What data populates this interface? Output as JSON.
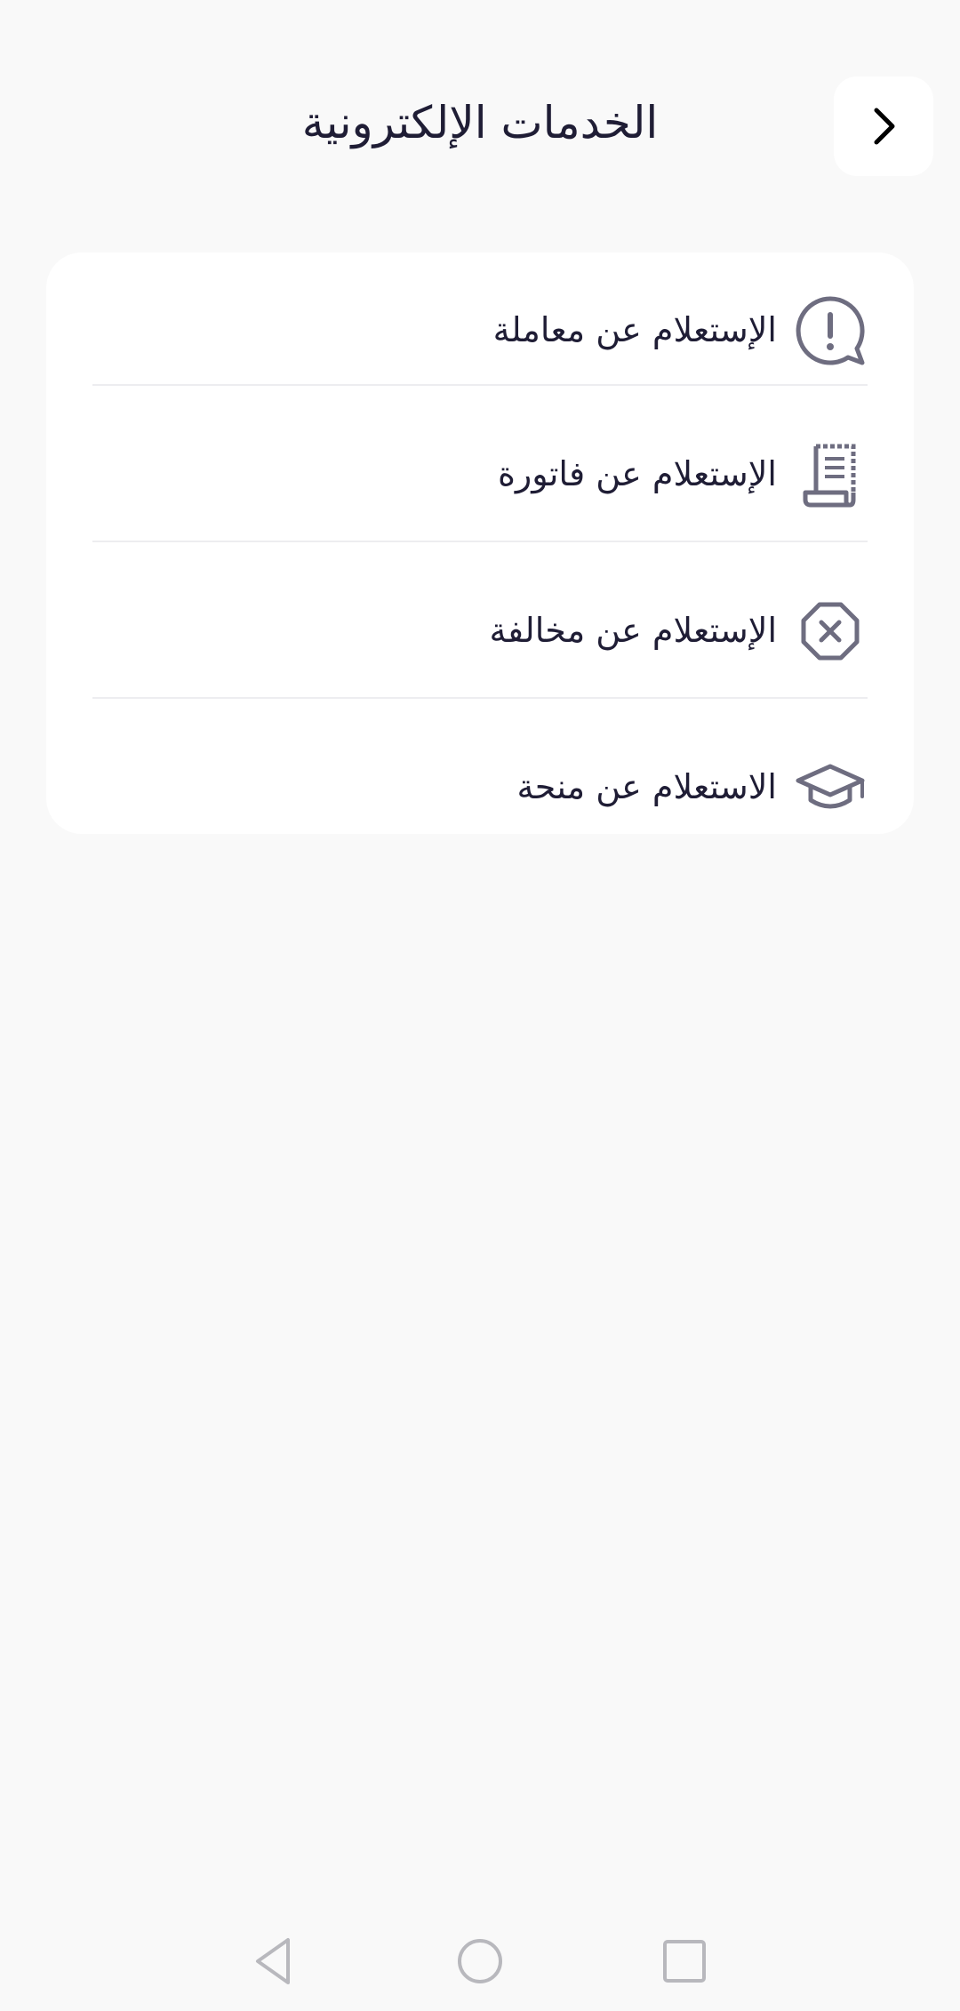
{
  "header": {
    "title": "الخدمات الإلكترونية",
    "back_icon": "chevron-right-icon"
  },
  "services": [
    {
      "label": "الإستعلام عن معاملة",
      "icon": "alert-chat-icon"
    },
    {
      "label": "الإستعلام عن فاتورة",
      "icon": "receipt-icon"
    },
    {
      "label": "الإستعلام عن مخالفة",
      "icon": "octagon-x-icon"
    },
    {
      "label": "الاستعلام عن منحة",
      "icon": "graduation-cap-icon"
    }
  ],
  "colors": {
    "background": "#f9f9f9",
    "card": "#ffffff",
    "text": "#1f1d35",
    "icon": "#6e6d80",
    "divider": "#ededf0"
  },
  "nav": {
    "back": "triangle-back-icon",
    "home": "circle-home-icon",
    "recents": "square-recents-icon"
  }
}
